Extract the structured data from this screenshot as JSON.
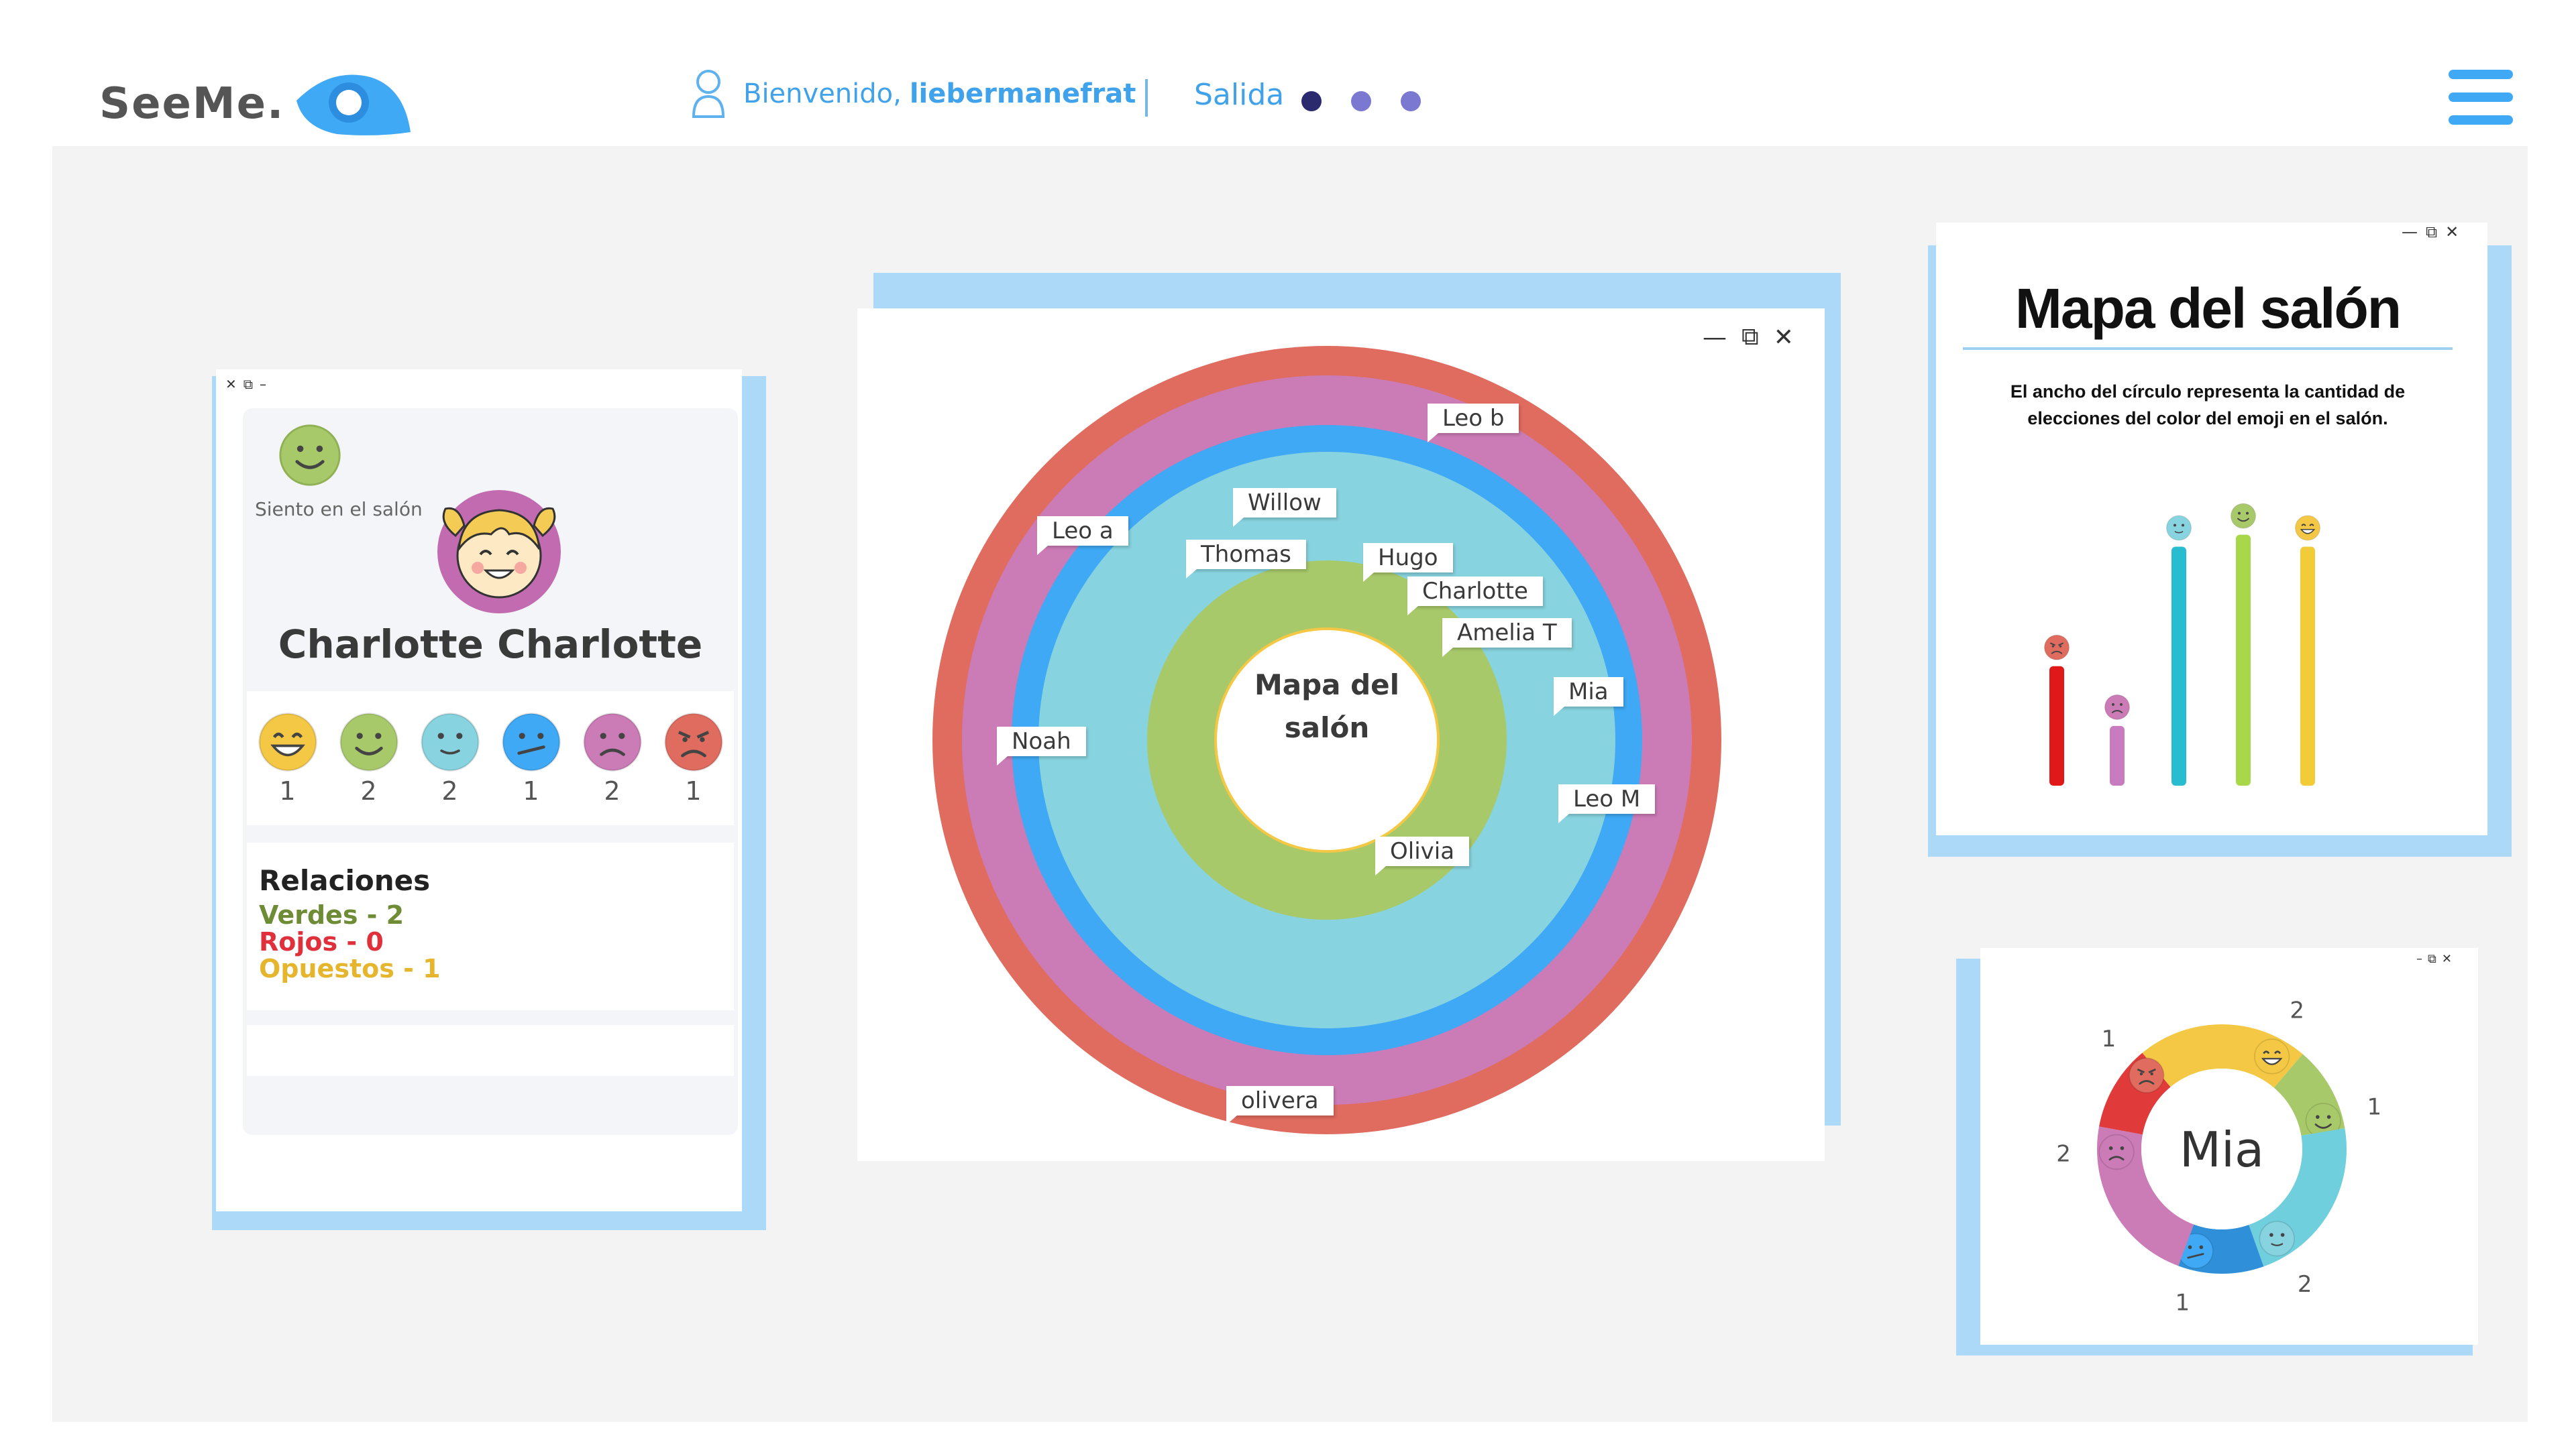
{
  "header": {
    "logo_text": "SeeMe.",
    "welcome_prefix": "Bienvenido,",
    "username": "liebermanefrat",
    "logout_label": "Salida",
    "pagination_dots": 3
  },
  "colors": {
    "accent": "#3fa9f5",
    "frame": "#acd9f8",
    "workspace_bg": "#f3f3f3",
    "green": "#a8c96a",
    "lightblue": "#87d3df",
    "blue": "#3fa9f5",
    "purple": "#cb7bb5",
    "red": "#e06b5f",
    "yellow": "#f4c844"
  },
  "profile_card": {
    "feeling_label": "Siento en el salón",
    "feeling_icon": "smile-green-icon",
    "student_name": "Charlotte Charlotte",
    "emoji_counts": [
      {
        "icon": "laugh-yellow-icon",
        "count": "1"
      },
      {
        "icon": "smile-green-icon",
        "count": "2"
      },
      {
        "icon": "calm-lightblue-icon",
        "count": "2"
      },
      {
        "icon": "unsure-blue-icon",
        "count": "1"
      },
      {
        "icon": "sad-purple-icon",
        "count": "2"
      },
      {
        "icon": "angry-red-icon",
        "count": "1"
      }
    ],
    "relations_title": "Relaciones",
    "relations": [
      {
        "label": "Verdes - 2",
        "color": "#6e8c36"
      },
      {
        "label": "Rojos - 0",
        "color": "#e0303c"
      },
      {
        "label": "Opuestos - 1",
        "color": "#e6b52e"
      }
    ]
  },
  "classroom_map": {
    "center_title": "Mapa del salón",
    "students": [
      "Leo b",
      "Willow",
      "Leo a",
      "Thomas",
      "Hugo",
      "Charlotte",
      "Amelia T",
      "Mia",
      "Noah",
      "Leo M",
      "Olivia",
      "olivera"
    ]
  },
  "bar_panel": {
    "title": "Mapa del salón",
    "description": "El ancho del círculo representa la cantidad de elecciones del color del emoji en el salón.",
    "chart_data": {
      "type": "bar",
      "categories": [
        "angry-red",
        "sad-purple",
        "calm-lightblue",
        "smile-green",
        "laugh-yellow"
      ],
      "values": [
        1,
        0.5,
        2,
        2.1,
        2
      ],
      "ylim": [
        0,
        2.3
      ],
      "colors": [
        "#e01818",
        "#c87bbf",
        "#27bcd0",
        "#a8d84a",
        "#f2cc38"
      ],
      "icons": [
        "angry-red-icon",
        "sad-purple-icon",
        "calm-lightblue-icon",
        "smile-green-icon",
        "laugh-yellow-icon"
      ]
    }
  },
  "donut_panel": {
    "name": "Mia",
    "segments": [
      {
        "icon": "laugh-yellow-icon",
        "label": "2",
        "color": "#f4c844"
      },
      {
        "icon": "smile-green-icon",
        "label": "1",
        "color": "#a8c96a"
      },
      {
        "icon": "calm-lightblue-icon",
        "label": "2",
        "color": "#6fcfdc"
      },
      {
        "icon": "unsure-blue-icon",
        "label": "1",
        "color": "#2f8fd8"
      },
      {
        "icon": "sad-purple-icon",
        "label": "2",
        "color": "#cb7bb5"
      },
      {
        "icon": "angry-red-icon",
        "label": "1",
        "color": "#e03a3a"
      }
    ]
  }
}
